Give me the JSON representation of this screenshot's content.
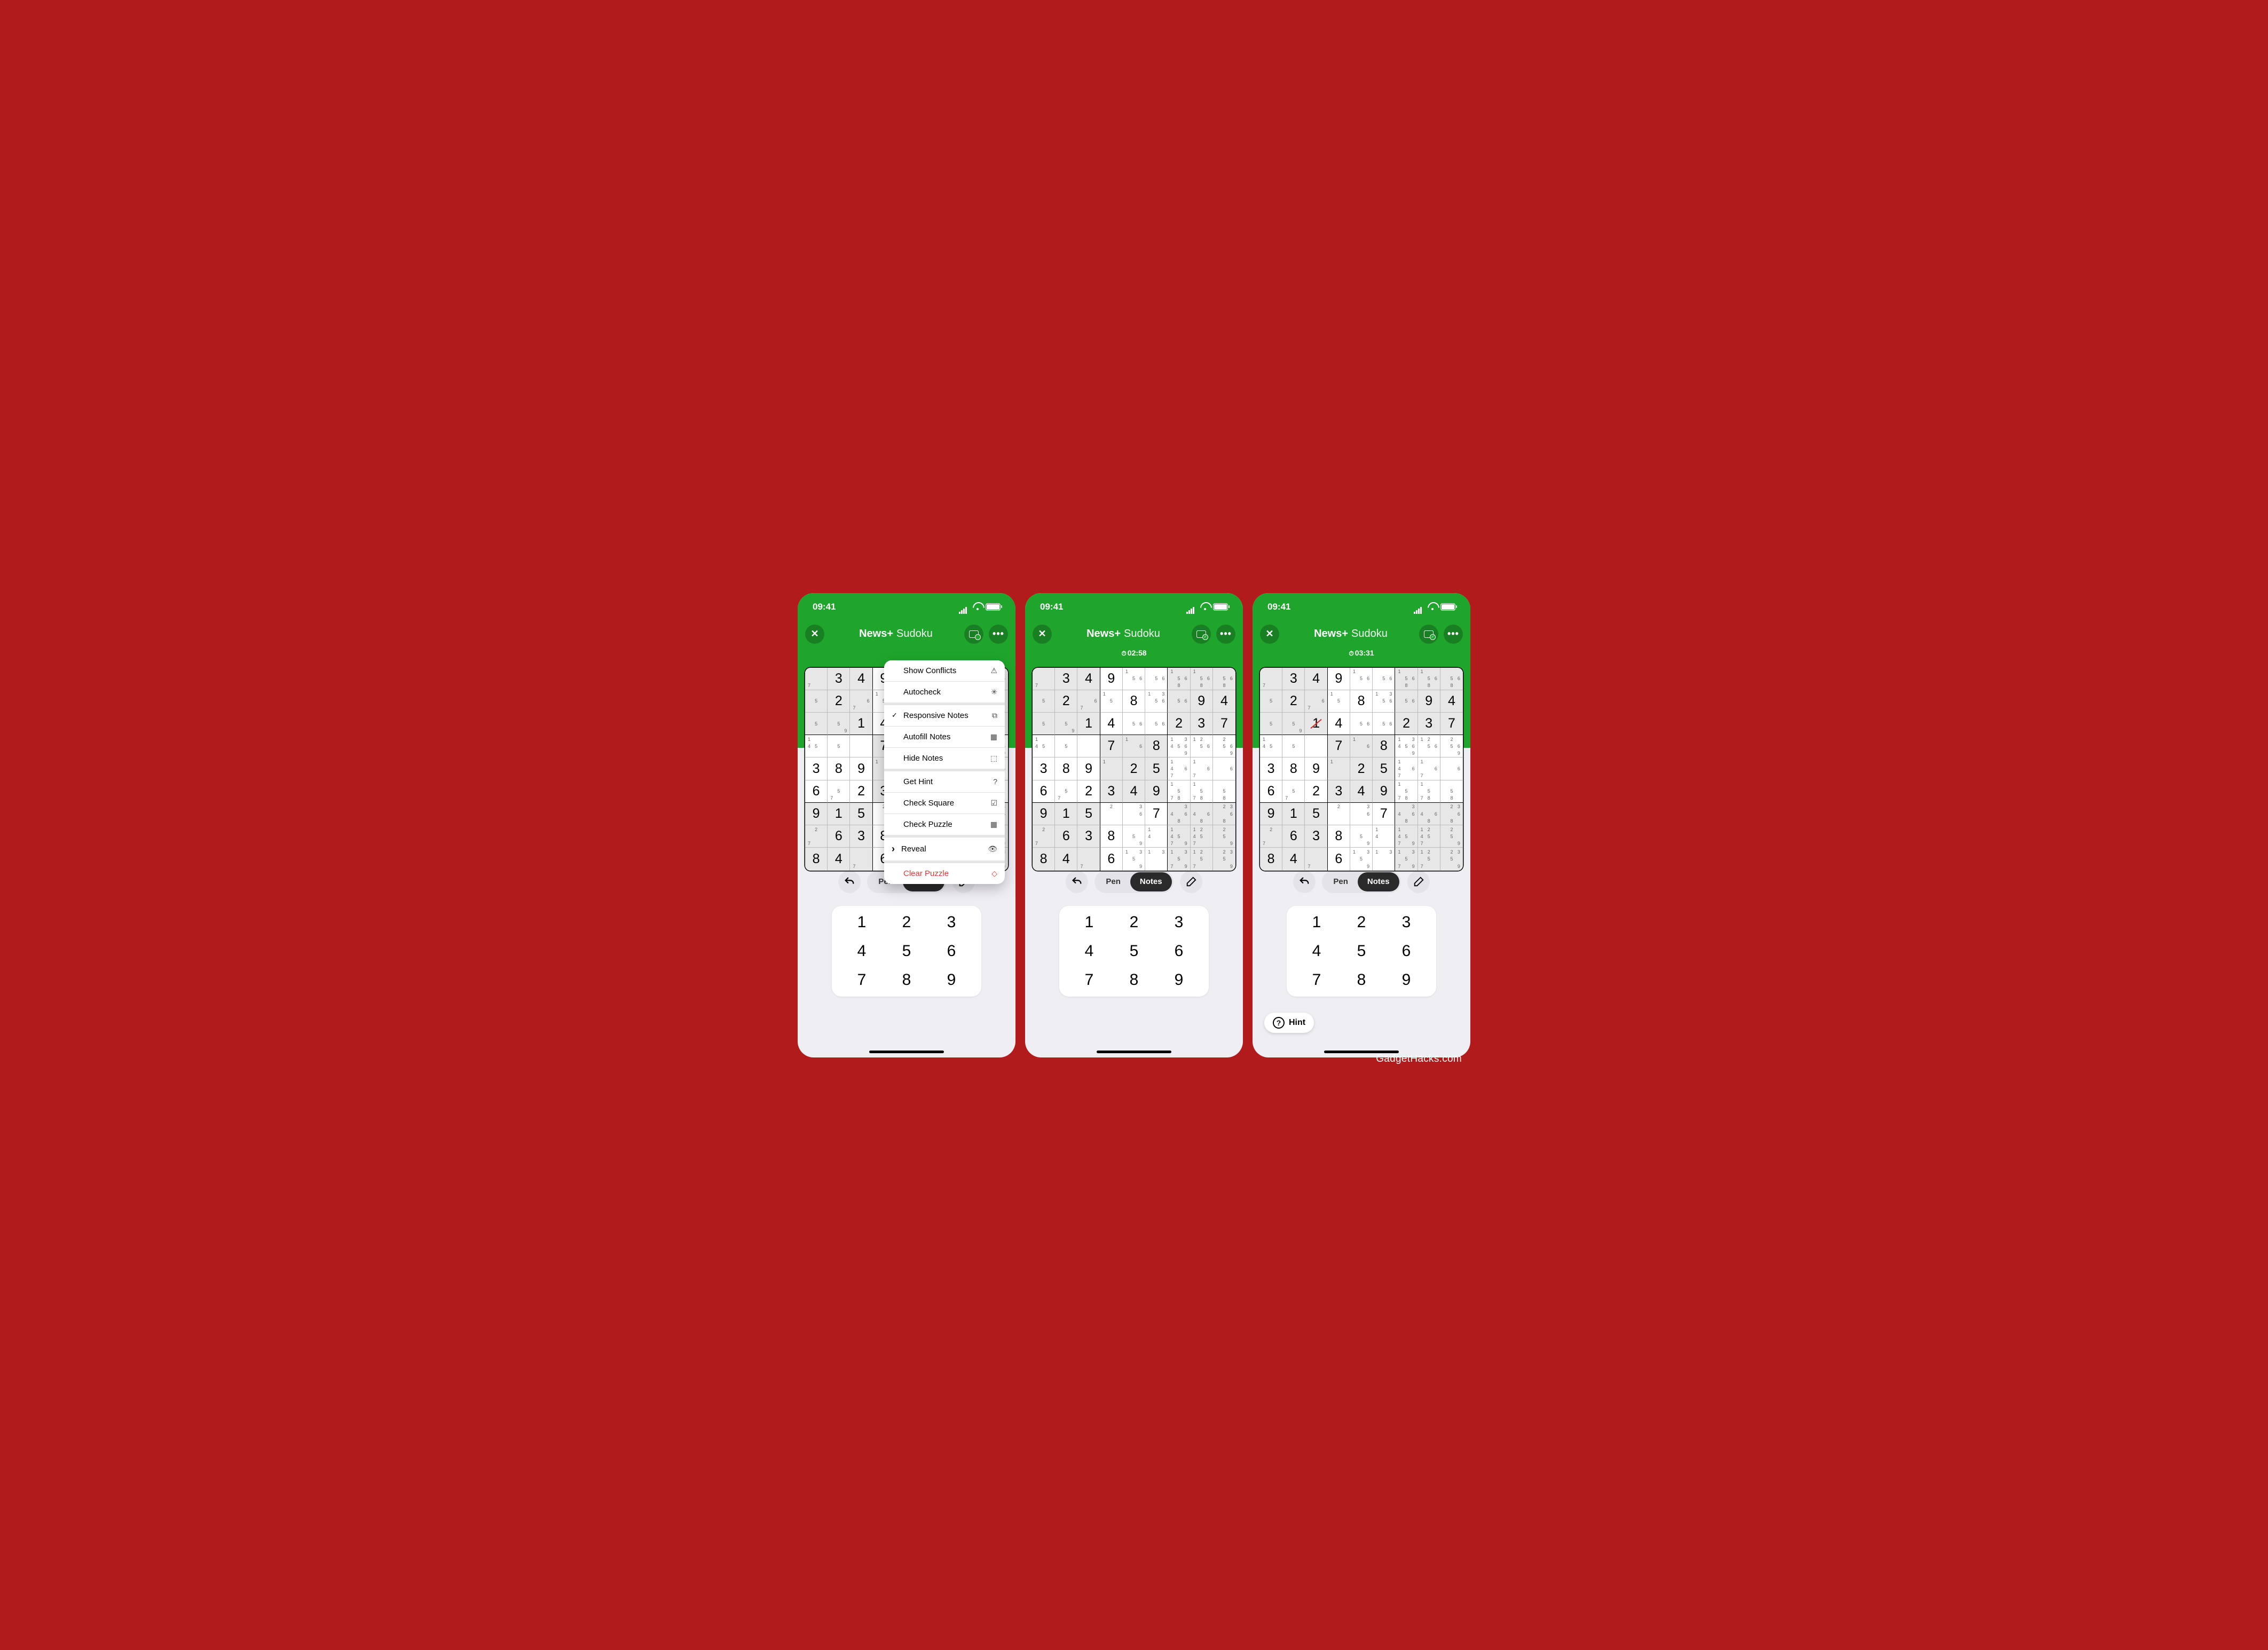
{
  "status": {
    "time": "09:41"
  },
  "app_title": {
    "brand": "News+",
    "game": "Sudoku"
  },
  "timers": {
    "s1": "",
    "s2": "02:58",
    "s3": "03:31"
  },
  "tool_row": {
    "pen": "Pen",
    "notes": "Notes"
  },
  "num_pad": [
    "1",
    "2",
    "3",
    "4",
    "5",
    "6",
    "7",
    "8",
    "9"
  ],
  "hint": {
    "label": "Hint"
  },
  "watermark": "GadgetHacks.com",
  "menu": {
    "show_conflicts": "Show Conflicts",
    "autocheck": "Autocheck",
    "responsive_notes": "Responsive Notes",
    "autofill_notes": "Autofill Notes",
    "hide_notes": "Hide Notes",
    "get_hint": "Get Hint",
    "check_square": "Check Square",
    "check_puzzle": "Check Puzzle",
    "reveal": "Reveal",
    "clear_puzzle": "Clear Puzzle"
  },
  "chart_data": {
    "type": "table",
    "description": "9x9 Sudoku grid state shared across the three screenshots. 'v' is the placed digit (null if empty), 'n' is the array of pencil-note candidates shown in the cell.",
    "cells": [
      [
        {
          "v": null,
          "n": [
            7
          ]
        },
        {
          "v": 3,
          "n": []
        },
        {
          "v": 4,
          "n": []
        },
        {
          "v": 9,
          "n": []
        },
        {
          "v": null,
          "n": [
            1,
            5,
            6
          ]
        },
        {
          "v": null,
          "n": [
            5,
            6
          ]
        },
        {
          "v": null,
          "n": [
            1,
            5,
            6,
            8
          ]
        },
        {
          "v": null,
          "n": [
            1,
            5,
            6,
            8
          ]
        },
        {
          "v": null,
          "n": [
            5,
            6,
            8
          ]
        }
      ],
      [
        {
          "v": null,
          "n": [
            5
          ]
        },
        {
          "v": 2,
          "n": []
        },
        {
          "v": null,
          "n": [
            6,
            7
          ]
        },
        {
          "v": null,
          "n": [
            1,
            5
          ]
        },
        {
          "v": 8,
          "n": []
        },
        {
          "v": null,
          "n": [
            1,
            3,
            5,
            6
          ]
        },
        {
          "v": null,
          "n": [
            5,
            6
          ]
        },
        {
          "v": 9,
          "n": []
        },
        {
          "v": 4,
          "n": []
        }
      ],
      [
        {
          "v": null,
          "n": [
            5
          ]
        },
        {
          "v": null,
          "n": [
            5,
            9
          ]
        },
        {
          "v": 1,
          "n": []
        },
        {
          "v": 4,
          "n": []
        },
        {
          "v": null,
          "n": [
            5,
            6
          ]
        },
        {
          "v": null,
          "n": [
            5,
            6
          ]
        },
        {
          "v": 2,
          "n": []
        },
        {
          "v": 3,
          "n": []
        },
        {
          "v": 7,
          "n": []
        }
      ],
      [
        {
          "v": null,
          "n": [
            1,
            4,
            5
          ]
        },
        {
          "v": null,
          "n": [
            5
          ]
        },
        {
          "v": null,
          "n": []
        },
        {
          "v": 7,
          "n": []
        },
        {
          "v": null,
          "n": [
            1,
            6
          ]
        },
        {
          "v": 8,
          "n": []
        },
        {
          "v": null,
          "n": [
            1,
            3,
            4,
            5,
            6,
            9
          ]
        },
        {
          "v": null,
          "n": [
            1,
            2,
            5,
            6
          ]
        },
        {
          "v": null,
          "n": [
            2,
            5,
            6,
            9
          ]
        }
      ],
      [
        {
          "v": 3,
          "n": []
        },
        {
          "v": 8,
          "n": []
        },
        {
          "v": 9,
          "n": []
        },
        {
          "v": null,
          "n": [
            1
          ]
        },
        {
          "v": 2,
          "n": []
        },
        {
          "v": 5,
          "n": []
        },
        {
          "v": null,
          "n": [
            1,
            4,
            6,
            7
          ]
        },
        {
          "v": null,
          "n": [
            1,
            6,
            7
          ]
        },
        {
          "v": null,
          "n": [
            6
          ]
        }
      ],
      [
        {
          "v": 6,
          "n": []
        },
        {
          "v": null,
          "n": [
            5,
            7
          ]
        },
        {
          "v": 2,
          "n": []
        },
        {
          "v": 3,
          "n": []
        },
        {
          "v": 4,
          "n": []
        },
        {
          "v": 9,
          "n": []
        },
        {
          "v": null,
          "n": [
            1,
            5,
            7,
            8
          ]
        },
        {
          "v": null,
          "n": [
            1,
            5,
            7,
            8
          ]
        },
        {
          "v": null,
          "n": [
            5,
            8
          ]
        }
      ],
      [
        {
          "v": 9,
          "n": []
        },
        {
          "v": 1,
          "n": []
        },
        {
          "v": 5,
          "n": []
        },
        {
          "v": null,
          "n": [
            2
          ]
        },
        {
          "v": null,
          "n": [
            3,
            6
          ]
        },
        {
          "v": 7,
          "n": []
        },
        {
          "v": null,
          "n": [
            3,
            4,
            6,
            8
          ]
        },
        {
          "v": null,
          "n": [
            4,
            6,
            8
          ]
        },
        {
          "v": null,
          "n": [
            2,
            3,
            6,
            8
          ]
        }
      ],
      [
        {
          "v": null,
          "n": [
            2,
            7
          ]
        },
        {
          "v": 6,
          "n": []
        },
        {
          "v": 3,
          "n": []
        },
        {
          "v": 8,
          "n": []
        },
        {
          "v": null,
          "n": [
            5,
            9
          ]
        },
        {
          "v": null,
          "n": [
            1,
            4
          ]
        },
        {
          "v": null,
          "n": [
            1,
            4,
            5,
            7,
            9
          ]
        },
        {
          "v": null,
          "n": [
            1,
            2,
            4,
            5,
            7
          ]
        },
        {
          "v": null,
          "n": [
            2,
            5,
            9
          ]
        }
      ],
      [
        {
          "v": 8,
          "n": []
        },
        {
          "v": 4,
          "n": []
        },
        {
          "v": null,
          "n": [
            7
          ]
        },
        {
          "v": 6,
          "n": []
        },
        {
          "v": null,
          "n": [
            1,
            3,
            5,
            9
          ]
        },
        {
          "v": null,
          "n": [
            1,
            3
          ]
        },
        {
          "v": null,
          "n": [
            1,
            3,
            5,
            7,
            9
          ]
        },
        {
          "v": null,
          "n": [
            1,
            2,
            5,
            7
          ]
        },
        {
          "v": null,
          "n": [
            2,
            3,
            5,
            9
          ]
        }
      ]
    ],
    "screen1_note": "dropdown menu overlaying the grid",
    "screen3_special": {
      "row": 2,
      "col": 2,
      "wrong_value": 1,
      "meaning": "user entered 1, shown crossed out as incorrect by Autocheck"
    }
  }
}
